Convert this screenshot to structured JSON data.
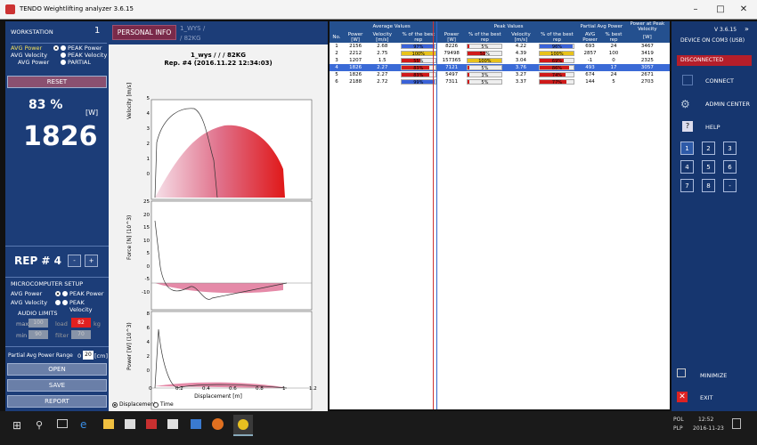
{
  "window": {
    "title": "TENDO Weightlifting analyzer 3.6.15"
  },
  "left": {
    "workstation_label": "WORKSTATION",
    "workstation_num": "1",
    "modes": [
      {
        "left": "AVG Power",
        "right": "PEAK Power"
      },
      {
        "left": "AVG Velocity",
        "right": "PEAK Velocity"
      },
      {
        "left": "AVG Power",
        "right": "PARTIAL"
      }
    ],
    "reset": "RESET",
    "percent": "83 %",
    "unit": "[W]",
    "value": "1826",
    "rep_label": "REP # 4",
    "minus": "-",
    "plus": "+",
    "micro_title": "MICROCOMPUTER SETUP",
    "micro_modes": [
      {
        "left": "AVG Power",
        "right": "PEAK Power"
      },
      {
        "left": "AVG Velocity",
        "right": "PEAK Velocity"
      }
    ],
    "audio_limits": "AUDIO LIMITS",
    "max_label": "max",
    "max_val": "100",
    "load_label": "load",
    "load_val": "82",
    "kg": "kg",
    "min_label": "min",
    "min_val": "90",
    "filter_label": "filter",
    "filter_val": "70",
    "partial_label": "Partial Avg Power Range",
    "partial_from": "0",
    "partial_to": "20",
    "partial_unit": "[cm]",
    "open": "OPEN",
    "save": "SAVE",
    "report": "REPORT"
  },
  "center": {
    "personal_info": "PERSONAL INFO",
    "athlete": "1_WYS /",
    "weight": "/ 82KG",
    "chart_head1": "1_wys /  /  /  82KG",
    "chart_head2": "Rep. #4    (2016.11.22 12:34:03)",
    "y1": "Velocity [m/s]",
    "y2": "Force [N] (10^3)",
    "y3": "Power [W] (10^3)",
    "xlabel": "Displacement [m]",
    "radio_disp": "Displacement",
    "radio_time": "Time",
    "ticks1": [
      "5",
      "4",
      "3",
      "2",
      "1",
      "0"
    ],
    "ticks2": [
      "25",
      "20",
      "15",
      "10",
      "5",
      "0",
      "-5",
      "-10"
    ],
    "ticks3": [
      "8",
      "6",
      "4",
      "2",
      "0"
    ],
    "xticks": [
      "0",
      "0.2",
      "0.4",
      "0.6",
      "0.8",
      "1",
      "1.2"
    ]
  },
  "table": {
    "groups": [
      "Average Values",
      "Peak Values",
      "Partial Avg Power",
      "Power at Peak Velocity"
    ],
    "headers": [
      "No.",
      "Power [W]",
      "Velocity [m/s]",
      "% of the best rep",
      "Power [W]",
      "% of the best rep",
      "Velocity [m/s]",
      "% of the best rep",
      "AVG Power",
      "% best rep",
      "[W]"
    ],
    "rows": [
      [
        "1",
        "2156",
        "2.68",
        "97%",
        "8226",
        "5%",
        "4.22",
        "96%",
        "693",
        "24",
        "3467"
      ],
      [
        "2",
        "2212",
        "2.75",
        "100%",
        "79498",
        "51%",
        "4.39",
        "100%",
        "2857",
        "100",
        "3419"
      ],
      [
        "3",
        "1207",
        "1.5",
        "55%",
        "157365",
        "100%",
        "3.04",
        "69%",
        "-1",
        "0",
        "2325"
      ],
      [
        "4",
        "1826",
        "2.27",
        "83%",
        "7121",
        "5%",
        "3.76",
        "86%",
        "493",
        "17",
        "3057"
      ],
      [
        "5",
        "1826",
        "2.27",
        "83%",
        "5497",
        "3%",
        "3.27",
        "74%",
        "674",
        "24",
        "2671"
      ],
      [
        "6",
        "2188",
        "2.72",
        "99%",
        "7311",
        "5%",
        "3.37",
        "77%",
        "144",
        "5",
        "2703"
      ]
    ],
    "pct_colors": [
      "#3a62d8",
      "#e8c21a",
      "#d01a1a"
    ]
  },
  "right": {
    "version": "V 3.6.15",
    "device": "DEVICE ON COM3 (USB)",
    "status": "DISCONNECTED",
    "connect": "CONNECT",
    "admin": "ADMIN CENTER",
    "help": "HELP",
    "keys": [
      "1",
      "2",
      "3",
      "4",
      "5",
      "6",
      "7",
      "8",
      "-"
    ],
    "minimize": "MINIMIZE",
    "exit": "EXIT"
  },
  "taskbar": {
    "lang1": "POL",
    "lang2": "PLP",
    "time": "12:52",
    "date": "2016-11-23"
  }
}
